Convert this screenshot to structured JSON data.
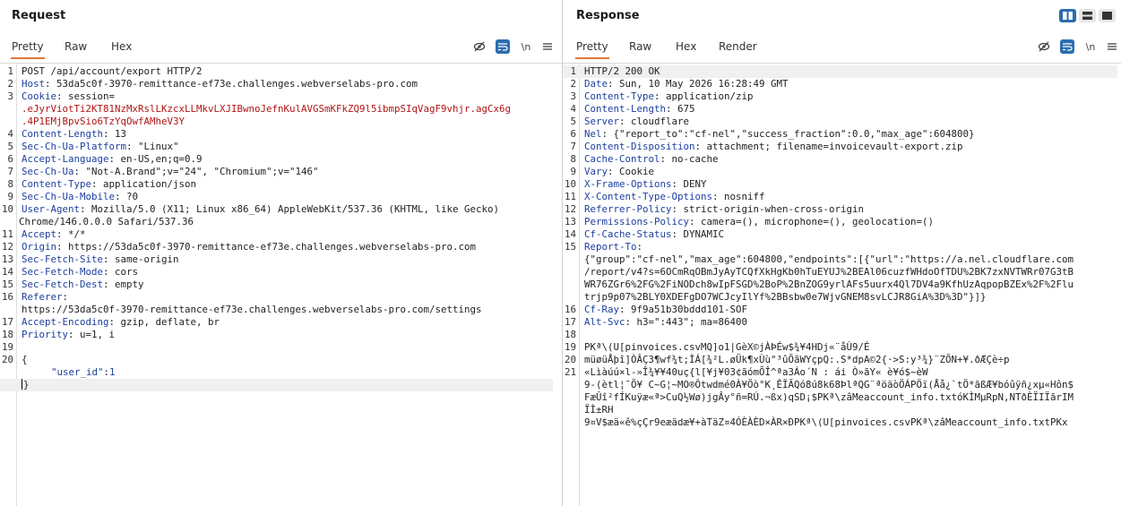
{
  "request": {
    "title": "Request",
    "tabs": [
      "Pretty",
      "Raw",
      "Hex"
    ],
    "tools": {
      "newline_label": "\\n"
    },
    "line_numbers": [
      "1",
      "2",
      "3",
      "",
      "",
      "4",
      "5",
      "6",
      "7",
      "8",
      "9",
      "10",
      "",
      "11",
      "12",
      "13",
      "14",
      "15",
      "16",
      "",
      "17",
      "18",
      "19",
      "20",
      "",
      ""
    ],
    "lines": {
      "l1": "POST /api/account/export HTTP/2",
      "l2n": "Host",
      "l2v": ": 53da5c0f-3970-remittance-ef73e.challenges.webverselabs-pro.com",
      "l3n": "Cookie",
      "l3v": ": session=",
      "l3c1": ".eJyrViotTi2KT81NzMxRslLKzcxLLMkvLXJIBwnoJefnKulAVGSmKFkZQ9l5ibmpSIqVagF9vhjr.agCx6g",
      "l3c2": ".4P1EMjBpvSio6TzYqOwfAMheV3Y",
      "l4n": "Content-Length",
      "l4v": ": 13",
      "l5n": "Sec-Ch-Ua-Platform",
      "l5v": ": \"Linux\"",
      "l6n": "Accept-Language",
      "l6v": ": en-US,en;q=0.9",
      "l7n": "Sec-Ch-Ua",
      "l7v": ": \"Not-A.Brand\";v=\"24\", \"Chromium\";v=\"146\"",
      "l8n": "Content-Type",
      "l8v": ": application/json",
      "l9n": "Sec-Ch-Ua-Mobile",
      "l9v": ": ?0",
      "l10n": "User-Agent",
      "l10v": ": Mozilla/5.0 (X11; Linux x86_64) AppleWebKit/537.36 (KHTML, like Gecko)",
      "l10c": "Chrome/146.0.0.0 Safari/537.36",
      "l11n": "Accept",
      "l11v": ": */*",
      "l12n": "Origin",
      "l12v": ": https://53da5c0f-3970-remittance-ef73e.challenges.webverselabs-pro.com",
      "l13n": "Sec-Fetch-Site",
      "l13v": ": same-origin",
      "l14n": "Sec-Fetch-Mode",
      "l14v": ": cors",
      "l15n": "Sec-Fetch-Dest",
      "l15v": ": empty",
      "l16n": "Referer",
      "l16v": ":",
      "l16c": "https://53da5c0f-3970-remittance-ef73e.challenges.webverselabs-pro.com/settings",
      "l17n": "Accept-Encoding",
      "l17v": ": gzip, deflate, br",
      "l18n": "Priority",
      "l18v": ": u=1, i",
      "l20": "{",
      "l21k": "\"user_id\"",
      "l21s": ":",
      "l21v": "1",
      "l22": "}"
    }
  },
  "response": {
    "title": "Response",
    "tabs": [
      "Pretty",
      "Raw",
      "Hex",
      "Render"
    ],
    "tools": {
      "newline_label": "\\n"
    },
    "line_numbers": [
      "1",
      "2",
      "3",
      "4",
      "5",
      "6",
      "7",
      "8",
      "9",
      "10",
      "11",
      "12",
      "13",
      "14",
      "15",
      "",
      "",
      "",
      "",
      "16",
      "17",
      "18",
      "19",
      "20",
      "21",
      "",
      "",
      "",
      "",
      "",
      ""
    ],
    "lines": {
      "l1": "HTTP/2 200 OK",
      "l2n": "Date",
      "l2v": ": Sun, 10 May 2026 16:28:49 GMT",
      "l3n": "Content-Type",
      "l3v": ": application/zip",
      "l4n": "Content-Length",
      "l4v": ": 675",
      "l5n": "Server",
      "l5v": ": cloudflare",
      "l6n": "Nel",
      "l6v": ": {\"report_to\":\"cf-nel\",\"success_fraction\":0.0,\"max_age\":604800}",
      "l7n": "Content-Disposition",
      "l7v": ": attachment; filename=invoicevault-export.zip",
      "l8n": "Cache-Control",
      "l8v": ": no-cache",
      "l9n": "Vary",
      "l9v": ": Cookie",
      "l10n": "X-Frame-Options",
      "l10v": ": DENY",
      "l11n": "X-Content-Type-Options",
      "l11v": ": nosniff",
      "l12n": "Referrer-Policy",
      "l12v": ": strict-origin-when-cross-origin",
      "l13n": "Permissions-Policy",
      "l13v": ": camera=(), microphone=(), geolocation=()",
      "l14n": "Cf-Cache-Status",
      "l14v": ": DYNAMIC",
      "l15n": "Report-To",
      "l15v": ":",
      "l15c1": "{\"group\":\"cf-nel\",\"max_age\":604800,\"endpoints\":[{\"url\":\"https://a.nel.cloudflare.com",
      "l15c2": "/report/v4?s=6OCmRqOBmJyAyTCQfXkHgKb0hTuEYUJ%2BEAl06cuzfWHdoOfTDU%2BK7zxNVTWRr07G3tB",
      "l15c3": "WR76ZGr6%2FG%2FiNODch8wIpFSGD%2BoP%2BnZOG9yrlAFs5uurx4Ql7DV4a9KfhUzAqpopBZEx%2F%2Flu",
      "l15c4": "trjp9p07%2BLY0XDEFgDO7WCJcyIlYf%2BBsbw0e7WjvGNEM8svLCJR8GiA%3D%3D\"}]}",
      "l16n": "Cf-Ray",
      "l16v": ": 9f9a51b30bddd101-SOF",
      "l17n": "Alt-Svc",
      "l17v": ": h3=\":443\"; ma=86400",
      "l20": "PKª\\(U[pinvoices.csvMQ]o1|GèX©jÀÞÉw$¾¥4HDj«¨åÙ9/É",
      "l21": "müøüÅþî]ÒÂÇ3¶wf¾t;ÌÁ[¾²L.øÜk¶xÙù\"³ûÕãWYçpQ:.S*dpA©2{·>S:y³¾}¨ZÕN+¥.ðÆÇè÷p",
      "l21c1": "«Lìàúú×l-»Î¾¥¥40uç{l[¥j¥03¢ãómÕÎ^ªa3Áo´N : ái Ò»ãY« è¥ó$~èW",
      "l21c2": "9-(ètl¦¯Ö¥ C~G¦~MO®Ôtwdmé0À¥Öò°K¸ÊÏÃQó8ú8k68ÞlªQG¨ªöäòÖÁPÖï(Åå¿`tÖ*ãßÆ¥bóûÿñ¿xµ«Hôn$",
      "l21c3": "FæÛî²fÍKuÿæ«ª>CuQ½Wø)jgÂy°ñ=RÚ.¬ßx)qSD¡$PKª\\zâMeaccount_info.txtóKÌMµRpN,NTðÈÏIÏãrIM",
      "l21c4": "ÏÌ±RH",
      "l21c5": "9¤V$æä«ê%çÇr9eæädæ¥+àTäZ¤4ÓÈÀÈD×ÀR×ÐPKª\\(U[pinvoices.csvPKª\\zâMeaccount_info.txtPKx"
    }
  }
}
